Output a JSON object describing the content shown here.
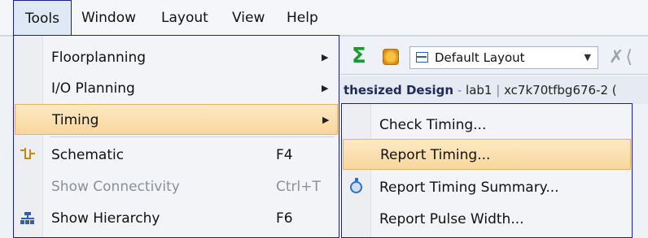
{
  "menubar": {
    "items": [
      "Tools",
      "Window",
      "Layout",
      "View",
      "Help"
    ]
  },
  "toolbar": {
    "layout_select": "Default Layout"
  },
  "design_bar": {
    "design_name": "thesized Design",
    "separator1": " - ",
    "project": "lab1",
    "separator2": " | ",
    "part": "xc7k70tfbg676-2 ("
  },
  "tools_menu": {
    "items": [
      {
        "label": "Floorplanning",
        "shortcut": "",
        "submenu": true,
        "enabled": true
      },
      {
        "label": "I/O Planning",
        "shortcut": "",
        "submenu": true,
        "enabled": true
      },
      {
        "label": "Timing",
        "shortcut": "",
        "submenu": true,
        "enabled": true,
        "highlighted": true
      },
      {
        "label": "Schematic",
        "shortcut": "F4",
        "submenu": false,
        "enabled": true,
        "icon": "schematic-icon"
      },
      {
        "label": "Show Connectivity",
        "shortcut": "Ctrl+T",
        "submenu": false,
        "enabled": false
      },
      {
        "label": "Show Hierarchy",
        "shortcut": "F6",
        "submenu": false,
        "enabled": true,
        "icon": "hierarchy-icon"
      }
    ]
  },
  "timing_submenu": {
    "items": [
      {
        "label": "Check Timing..."
      },
      {
        "label": "Report Timing...",
        "highlighted": true
      },
      {
        "label": "Report Timing Summary...",
        "icon": "stopwatch-icon"
      },
      {
        "label": "Report Pulse Width..."
      }
    ]
  },
  "colors": {
    "menu_border": "#1a1f8a",
    "highlight": "#f8d79c",
    "disabled_text": "#8a8f99"
  }
}
